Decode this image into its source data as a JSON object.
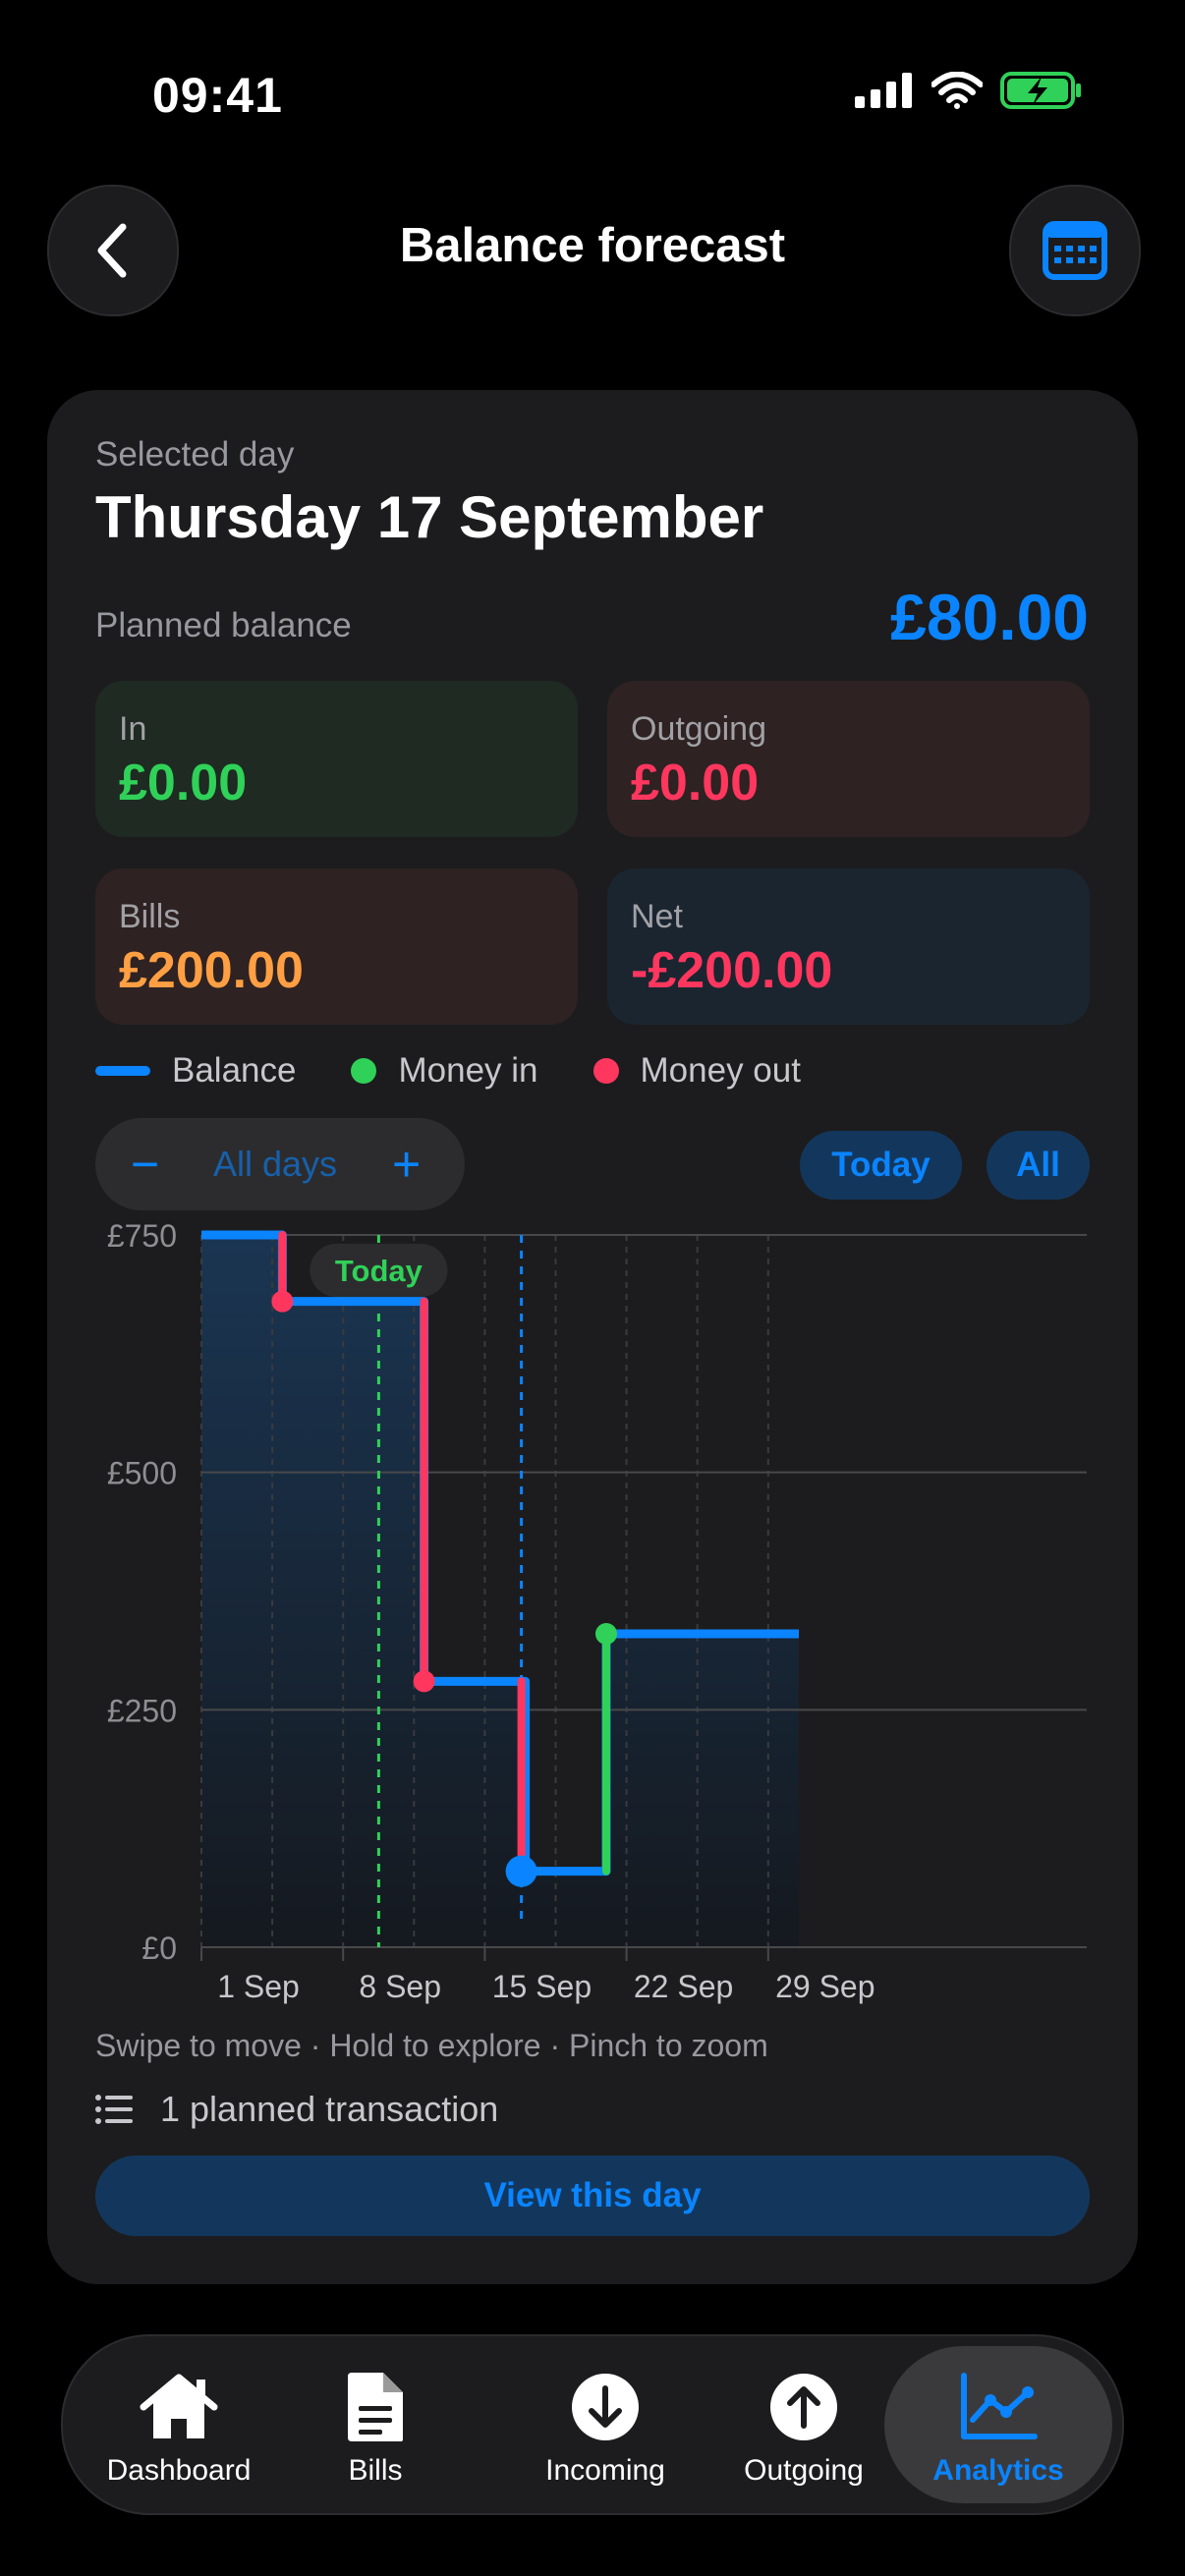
{
  "status_bar": {
    "time": "09:41"
  },
  "header": {
    "title": "Balance forecast"
  },
  "summary": {
    "selected_label": "Selected day",
    "selected_date": "Thursday 17 September",
    "planned_label": "Planned balance",
    "planned_value": "£80.00",
    "tiles": {
      "in": {
        "label": "In",
        "value": "£0.00"
      },
      "outgoing": {
        "label": "Outgoing",
        "value": "£0.00"
      },
      "bills": {
        "label": "Bills",
        "value": "£200.00"
      },
      "net": {
        "label": "Net",
        "value": "-£200.00"
      }
    }
  },
  "legend": {
    "balance": "Balance",
    "money_in": "Money in",
    "money_out": "Money out"
  },
  "controls": {
    "minus": "−",
    "range": "All days",
    "plus": "+",
    "today": "Today",
    "all": "All"
  },
  "chart_data": {
    "type": "line",
    "step": true,
    "x_unit": "day of September",
    "x_ticks": [
      {
        "day": 1,
        "label": "1 Sep"
      },
      {
        "day": 8,
        "label": "8 Sep"
      },
      {
        "day": 15,
        "label": "15 Sep"
      },
      {
        "day": 22,
        "label": "22 Sep"
      },
      {
        "day": 29,
        "label": "29 Sep"
      }
    ],
    "y_ticks": [
      {
        "value": 750,
        "label": "£750"
      },
      {
        "value": 500,
        "label": "£500"
      },
      {
        "value": 250,
        "label": "£250"
      },
      {
        "value": 0,
        "label": "£0"
      }
    ],
    "ylim": [
      0,
      750
    ],
    "xlim": [
      1,
      31
    ],
    "grid": true,
    "today_day": 10,
    "today_label": "Today",
    "selected_day": 17,
    "series": [
      {
        "name": "Balance",
        "color": "#0a84ff",
        "points": [
          {
            "day": 1,
            "value": 750
          },
          {
            "day": 5,
            "value": 680
          },
          {
            "day": 12,
            "value": 280
          },
          {
            "day": 17,
            "value": 80
          },
          {
            "day": 21,
            "value": 330
          },
          {
            "day": 31,
            "value": 330
          }
        ]
      }
    ],
    "events": [
      {
        "day": 5,
        "from": 750,
        "to": 680,
        "kind": "out"
      },
      {
        "day": 12,
        "from": 680,
        "to": 280,
        "kind": "out"
      },
      {
        "day": 17,
        "from": 280,
        "to": 80,
        "kind": "out"
      },
      {
        "day": 21,
        "from": 80,
        "to": 330,
        "kind": "in"
      }
    ],
    "colors": {
      "in": "#30d158",
      "out": "#ff375f",
      "balance": "#0a84ff",
      "today": "#30d158"
    }
  },
  "hint": "Swipe to move · Hold to explore · Pinch to zoom",
  "planned_transactions": "1 planned transaction",
  "view_day_label": "View this day",
  "tabs": [
    {
      "label": "Dashboard",
      "icon": "house-icon"
    },
    {
      "label": "Bills",
      "icon": "document-icon"
    },
    {
      "label": "Incoming",
      "icon": "arrow-down-circle-icon"
    },
    {
      "label": "Outgoing",
      "icon": "arrow-up-circle-icon"
    },
    {
      "label": "Analytics",
      "icon": "chart-line-icon",
      "active": true
    }
  ],
  "colors": {
    "accent": "#0a84ff",
    "green": "#30d158",
    "red": "#ff375f",
    "orange": "#ff9f43"
  }
}
